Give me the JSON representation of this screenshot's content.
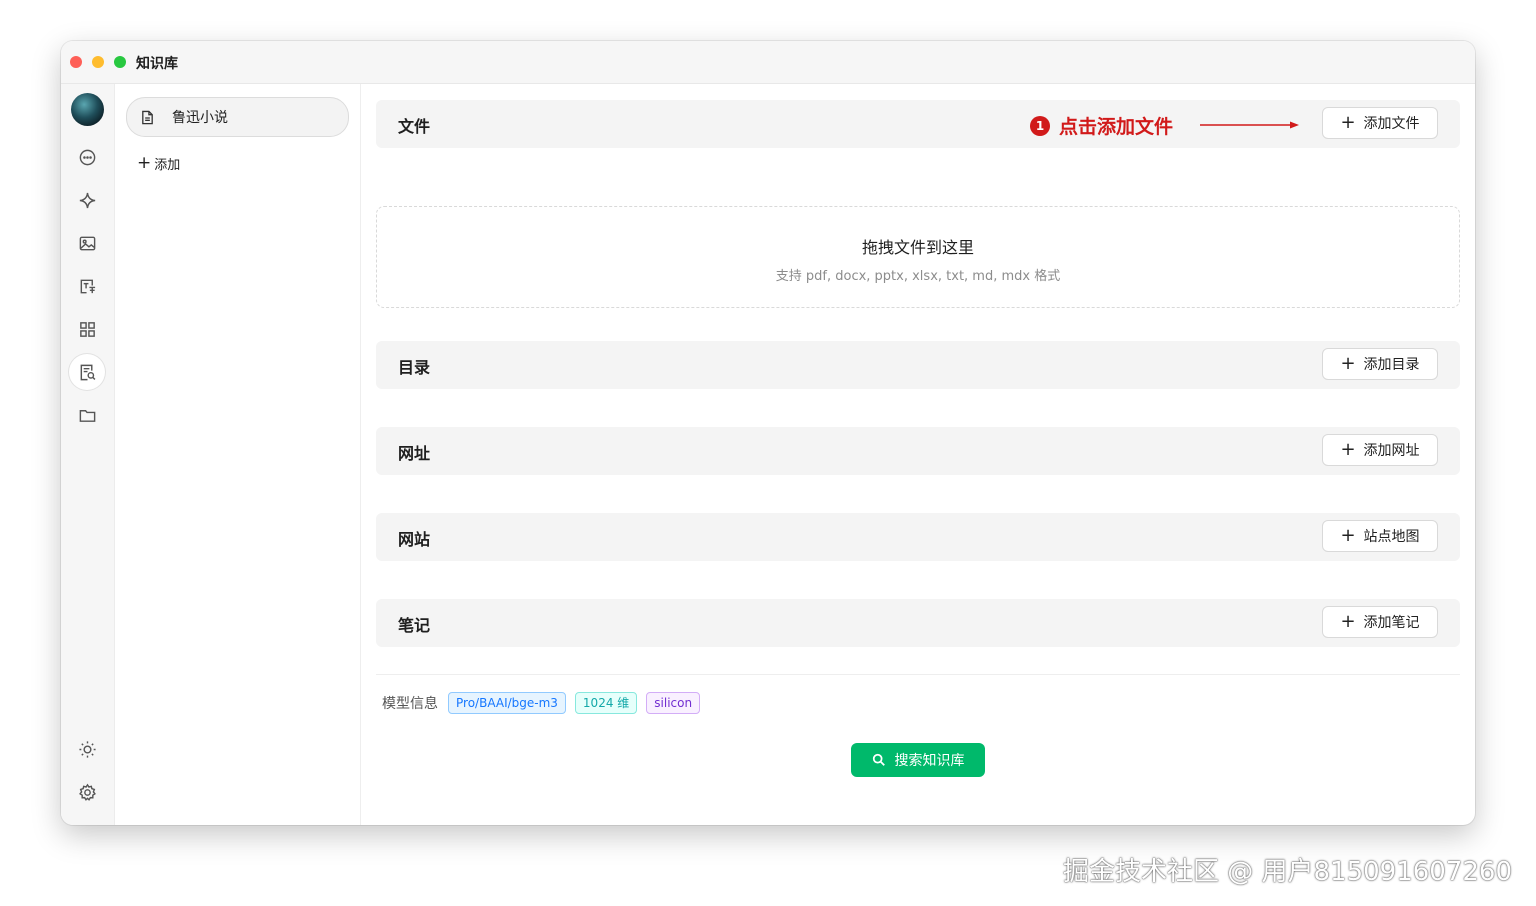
{
  "window": {
    "title": "知识库"
  },
  "iconbar": {
    "items": [
      "chat-icon",
      "sparkle-icon",
      "image-icon",
      "translate-icon",
      "apps-icon",
      "knowledge-icon",
      "folder-icon"
    ],
    "bottom": [
      "sun-icon",
      "settings-icon"
    ]
  },
  "kb_sidebar": {
    "items": [
      {
        "label": "鲁迅小说",
        "icon": "file-icon"
      }
    ],
    "add_label": "添加"
  },
  "sections": {
    "files": {
      "title": "文件",
      "button": "添加文件"
    },
    "directory": {
      "title": "目录",
      "button": "添加目录"
    },
    "url": {
      "title": "网址",
      "button": "添加网址"
    },
    "website": {
      "title": "网站",
      "button": "站点地图"
    },
    "notes": {
      "title": "笔记",
      "button": "添加笔记"
    }
  },
  "annotation": {
    "step": "1",
    "text": "点击添加文件",
    "color": "#d11a1a"
  },
  "dropzone": {
    "title": "拖拽文件到这里",
    "hint": "支持 pdf, docx, pptx, xlsx, txt, md, mdx 格式"
  },
  "model_info": {
    "label": "模型信息",
    "tags": [
      "Pro/BAAI/bge-m3",
      "1024 维",
      "silicon"
    ]
  },
  "search_button": {
    "label": "搜索知识库",
    "color": "#00b96b"
  },
  "watermark": "掘金技术社区 @ 用户815091607260"
}
